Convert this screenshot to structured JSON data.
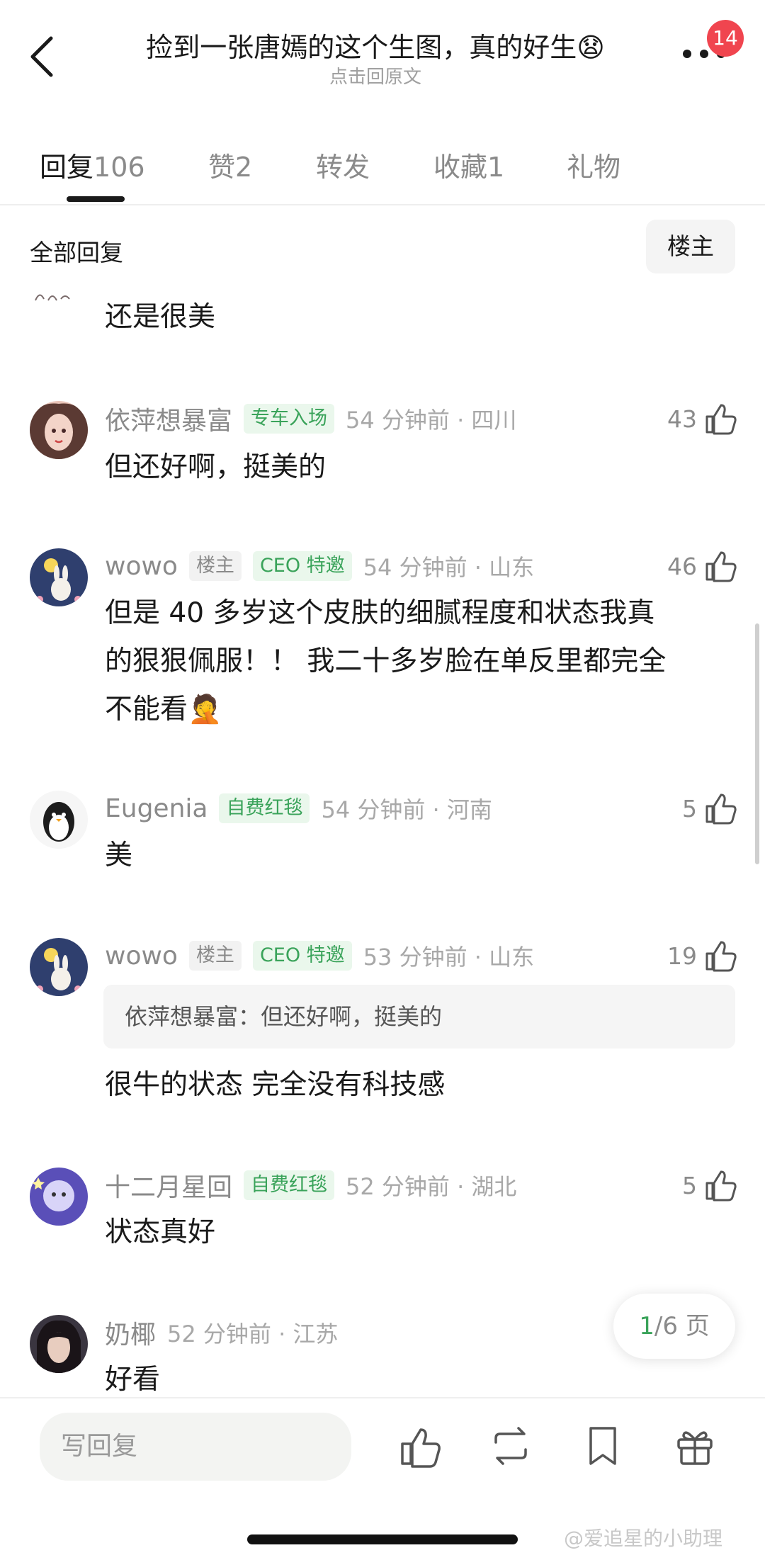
{
  "header": {
    "title": "捡到一张唐嫣的这个生图，真的好生😧",
    "subtitle": "点击回原文",
    "badge": "14"
  },
  "tabs": [
    {
      "label": "回复",
      "count": "106"
    },
    {
      "label": "赞",
      "count": "2"
    },
    {
      "label": "转发",
      "count": ""
    },
    {
      "label": "收藏",
      "count": "1"
    },
    {
      "label": "礼物",
      "count": ""
    }
  ],
  "filter": {
    "label": "全部回复",
    "button": "楼主"
  },
  "comments": [
    {
      "text": "还是很美"
    },
    {
      "name": "依萍想暴富",
      "tags": [
        "专车入场"
      ],
      "time": "54 分钟前 · 四川",
      "likes": "43",
      "text": "但还好啊，挺美的"
    },
    {
      "name": "wowo",
      "tags": [
        "楼主",
        "CEO 特邀"
      ],
      "time": "54 分钟前 · 山东",
      "likes": "46",
      "text_lines": [
        "但是 40 多岁这个皮肤的细腻程度和状态我真",
        "的狠狠佩服！！ 我二十多岁脸在单反里都完全",
        "不能看🤦"
      ]
    },
    {
      "name": "Eugenia",
      "tags": [
        "自费红毯"
      ],
      "time": "54 分钟前 · 河南",
      "likes": "5",
      "text": "美"
    },
    {
      "name": "wowo",
      "tags": [
        "楼主",
        "CEO 特邀"
      ],
      "time": "53 分钟前 · 山东",
      "likes": "19",
      "quote": "依萍想暴富：但还好啊，挺美的",
      "text": "很牛的状态 完全没有科技感"
    },
    {
      "name": "十二月星回",
      "tags": [
        "自费红毯"
      ],
      "time": "52 分钟前 · 湖北",
      "likes": "5",
      "text": "状态真好"
    },
    {
      "name": "奶椰",
      "tags": [],
      "time": "52 分钟前 · 江苏",
      "text": "好看"
    }
  ],
  "pager": {
    "current": "1",
    "rest": "/6 页"
  },
  "bottom": {
    "reply_placeholder": "写回复"
  },
  "watermark": "@爱追星的小助理",
  "colors": {
    "accent": "#3aa35a",
    "badge": "#f0454f"
  }
}
